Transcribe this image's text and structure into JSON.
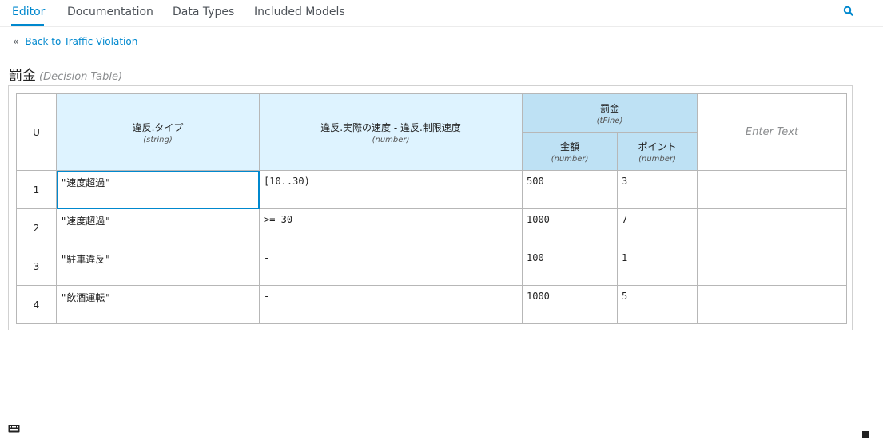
{
  "tabs": [
    {
      "label": "Editor"
    },
    {
      "label": "Documentation"
    },
    {
      "label": "Data Types"
    },
    {
      "label": "Included Models"
    }
  ],
  "back_link": "Back to Traffic Violation",
  "title": "罰金",
  "title_type": "(Decision Table)",
  "table": {
    "hit_policy": "U",
    "inputs": [
      {
        "name": "違反.タイプ",
        "type": "(string)"
      },
      {
        "name": "違反.実際の速度 - 違反.制限速度",
        "type": "(number)"
      }
    ],
    "output": {
      "name": "罰金",
      "type": "(tFine)",
      "components": [
        {
          "name": "金額",
          "type": "(number)"
        },
        {
          "name": "ポイント",
          "type": "(number)"
        }
      ]
    },
    "annotation_placeholder": "Enter Text",
    "rows": [
      {
        "num": "1",
        "c1": "\"速度超過\"",
        "c2": "[10..30)",
        "c3": "500",
        "c4": "3",
        "ann": ""
      },
      {
        "num": "2",
        "c1": "\"速度超過\"",
        "c2": ">= 30",
        "c3": "1000",
        "c4": "7",
        "ann": ""
      },
      {
        "num": "3",
        "c1": "\"駐車違反\"",
        "c2": "-",
        "c3": "100",
        "c4": "1",
        "ann": ""
      },
      {
        "num": "4",
        "c1": "\"飲酒運転\"",
        "c2": "-",
        "c3": "1000",
        "c4": "5",
        "ann": ""
      }
    ]
  },
  "colors": {
    "accent": "#0088ce",
    "input_header": "#def3ff",
    "output_header": "#bee1f4"
  }
}
